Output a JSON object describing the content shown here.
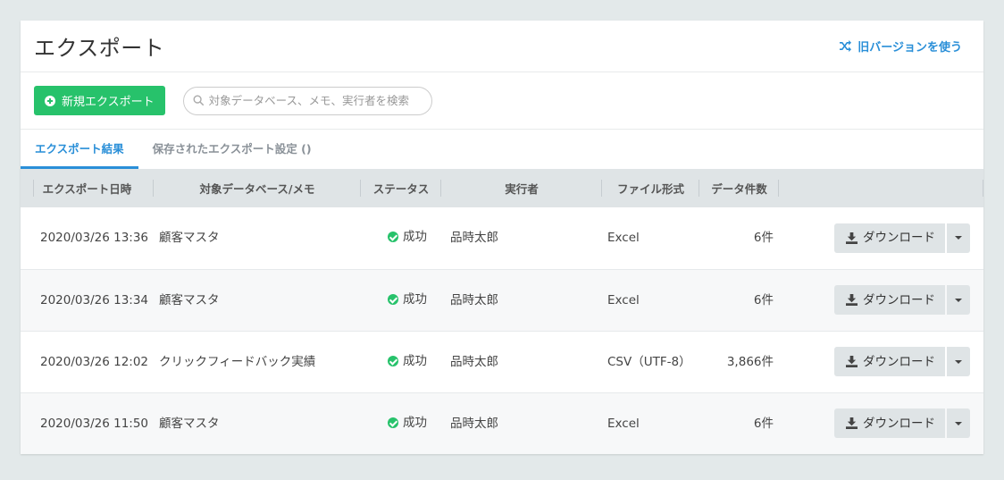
{
  "header": {
    "title": "エクスポート",
    "old_version_link": "旧バージョンを使う",
    "old_version_icon": "shuffle-icon"
  },
  "toolbar": {
    "new_export_label": "新規エクスポート",
    "search_placeholder": "対象データベース、メモ、実行者を検索",
    "search_value": ""
  },
  "tabs": [
    {
      "label": "エクスポート結果",
      "active": true
    },
    {
      "label": "保存されたエクスポート設定 ()",
      "active": false
    }
  ],
  "table": {
    "columns": [
      "エクスポート日時",
      "対象データベース/メモ",
      "ステータス",
      "実行者",
      "ファイル形式",
      "データ件数"
    ],
    "rows": [
      {
        "datetime": "2020/03/26 13:36",
        "target": "顧客マスタ",
        "status": "成功",
        "runner": "品時太郎",
        "format": "Excel",
        "count": "6件",
        "action": "ダウンロード"
      },
      {
        "datetime": "2020/03/26 13:34",
        "target": "顧客マスタ",
        "status": "成功",
        "runner": "品時太郎",
        "format": "Excel",
        "count": "6件",
        "action": "ダウンロード"
      },
      {
        "datetime": "2020/03/26 12:02",
        "target": "クリックフィードバック実績",
        "status": "成功",
        "runner": "品時太郎",
        "format": "CSV（UTF-8）",
        "count": "3,866件",
        "action": "ダウンロード"
      },
      {
        "datetime": "2020/03/26 11:50",
        "target": "顧客マスタ",
        "status": "成功",
        "runner": "品時太郎",
        "format": "Excel",
        "count": "6件",
        "action": "ダウンロード"
      }
    ]
  },
  "colors": {
    "accent_blue": "#2a8fd8",
    "success_green": "#27c26b",
    "header_gray": "#dfe4e6"
  }
}
